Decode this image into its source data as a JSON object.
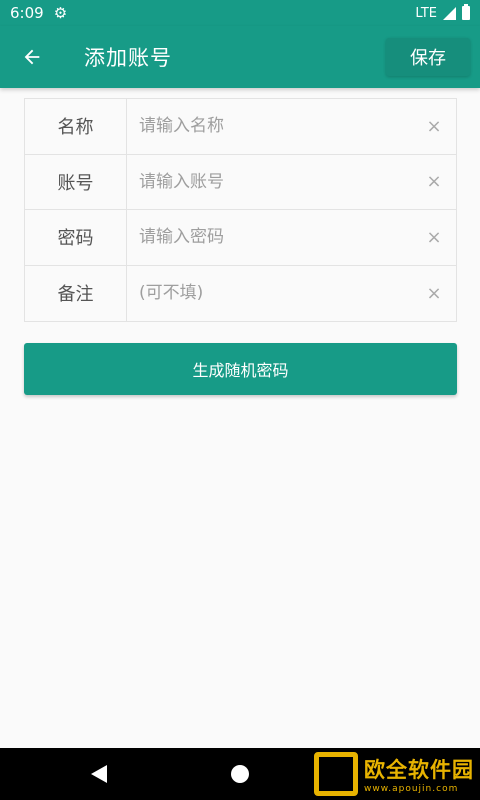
{
  "status_bar": {
    "time": "6:09",
    "network": "LTE",
    "icons": [
      "gear-icon",
      "signal-icon",
      "battery-icon"
    ]
  },
  "app_bar": {
    "title": "添加账号",
    "save_label": "保存",
    "back_icon": "arrow-left-icon",
    "color": "#179b87"
  },
  "form": {
    "rows": [
      {
        "label": "名称",
        "placeholder": "请输入名称",
        "value": ""
      },
      {
        "label": "账号",
        "placeholder": "请输入账号",
        "value": ""
      },
      {
        "label": "密码",
        "placeholder": "请输入密码",
        "value": ""
      },
      {
        "label": "备注",
        "placeholder": "(可不填)",
        "value": ""
      }
    ],
    "clear_icon": "×"
  },
  "generate_button": {
    "label": "生成随机密码"
  },
  "nav_bar": {
    "icons": [
      "nav-back-icon",
      "nav-home-icon"
    ]
  },
  "watermark": {
    "text": "欧全软件园",
    "url": "www.apoujin.com"
  }
}
